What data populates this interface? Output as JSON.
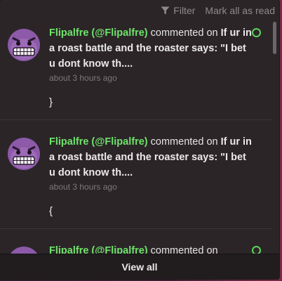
{
  "header": {
    "filter_label": "Filter",
    "mark_all_label": "Mark all as read"
  },
  "notifications": [
    {
      "user": "Flipalfre (@Flipalfre)",
      "verb": "commented on",
      "title": "If ur in a roast battle and the roaster says: \"I bet u dont know th....",
      "time": "about 3 hours ago",
      "body": "}",
      "unread": true
    },
    {
      "user": "Flipalfre (@Flipalfre)",
      "verb": "commented on",
      "title": "If ur in a roast battle and the roaster says: \"I bet u dont know th....",
      "time": "about 3 hours ago",
      "body": "{",
      "unread": false
    },
    {
      "user": "Flipalfre (@Flipalfre)",
      "verb": "commented on",
      "title": "",
      "time": "",
      "body": "",
      "unread": true
    }
  ],
  "footer": {
    "view_all_label": "View all"
  },
  "colors": {
    "username": "#6fe36a",
    "unread_dot": "#5dd45a",
    "panel_bg": "#2b2528"
  }
}
